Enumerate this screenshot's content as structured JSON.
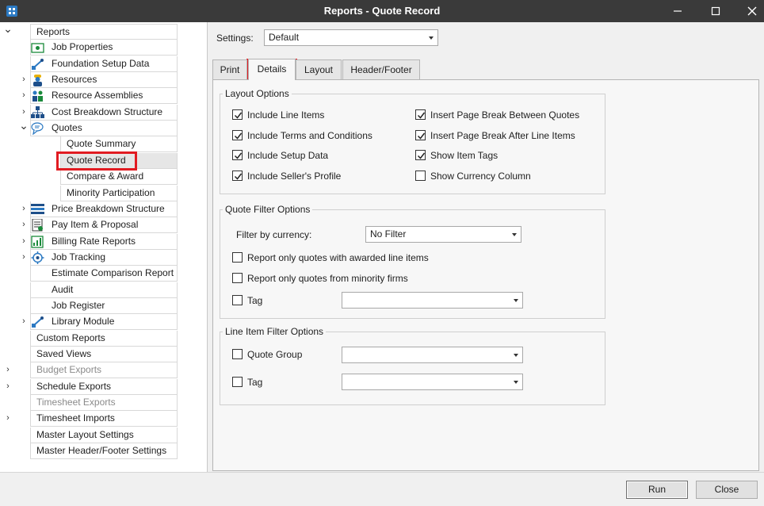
{
  "window": {
    "title": "Reports - Quote Record",
    "minimize": "—",
    "maximize": "☐",
    "close": "✕"
  },
  "tree": {
    "items": [
      {
        "label": "Reports",
        "chevron": "⌄",
        "icon": ""
      },
      {
        "label": "Job Properties",
        "chevron": "",
        "icon": "job-properties-icon"
      },
      {
        "label": "Foundation Setup Data",
        "chevron": "",
        "icon": "foundation-icon"
      },
      {
        "label": "Resources",
        "chevron": "›",
        "icon": "resources-icon"
      },
      {
        "label": "Resource Assemblies",
        "chevron": "›",
        "icon": "resource-assemblies-icon"
      },
      {
        "label": "Cost Breakdown Structure",
        "chevron": "›",
        "icon": "cost-breakdown-icon"
      },
      {
        "label": "Quotes",
        "chevron": "⌄",
        "icon": "quotes-icon"
      },
      {
        "label": "Quote Summary",
        "chevron": "",
        "icon": ""
      },
      {
        "label": "Quote Record",
        "chevron": "",
        "icon": ""
      },
      {
        "label": "Compare & Award",
        "chevron": "",
        "icon": ""
      },
      {
        "label": "Minority Participation",
        "chevron": "",
        "icon": ""
      },
      {
        "label": "Price Breakdown Structure",
        "chevron": "›",
        "icon": "price-breakdown-icon"
      },
      {
        "label": "Pay Item & Proposal",
        "chevron": "›",
        "icon": "pay-item-icon"
      },
      {
        "label": "Billing Rate Reports",
        "chevron": "›",
        "icon": "billing-rate-icon"
      },
      {
        "label": "Job Tracking",
        "chevron": "›",
        "icon": "job-tracking-icon"
      },
      {
        "label": "Estimate Comparison Report",
        "chevron": "",
        "icon": ""
      },
      {
        "label": "Audit",
        "chevron": "",
        "icon": ""
      },
      {
        "label": "Job Register",
        "chevron": "",
        "icon": ""
      },
      {
        "label": "Library Module",
        "chevron": "›",
        "icon": "library-icon"
      },
      {
        "label": "Custom Reports",
        "chevron": "",
        "icon": ""
      },
      {
        "label": "Saved Views",
        "chevron": "",
        "icon": ""
      },
      {
        "label": "Budget Exports",
        "chevron": "›",
        "icon": ""
      },
      {
        "label": "Schedule Exports",
        "chevron": "›",
        "icon": ""
      },
      {
        "label": "Timesheet Exports",
        "chevron": "",
        "icon": ""
      },
      {
        "label": "Timesheet Imports",
        "chevron": "›",
        "icon": ""
      },
      {
        "label": "Master Layout Settings",
        "chevron": "",
        "icon": ""
      },
      {
        "label": "Master Header/Footer Settings",
        "chevron": "",
        "icon": ""
      }
    ]
  },
  "settings": {
    "label": "Settings:",
    "value": "Default"
  },
  "tabs": [
    {
      "label": "Print"
    },
    {
      "label": "Details"
    },
    {
      "label": "Layout"
    },
    {
      "label": "Header/Footer"
    }
  ],
  "layout_options": {
    "title": "Layout Options",
    "left": [
      {
        "label": "Include Line Items",
        "checked": true
      },
      {
        "label": "Include Terms and Conditions",
        "checked": true
      },
      {
        "label": "Include Setup Data",
        "checked": true
      },
      {
        "label": "Include Seller's Profile",
        "checked": true
      }
    ],
    "right": [
      {
        "label": "Insert Page Break Between Quotes",
        "checked": true
      },
      {
        "label": "Insert Page Break After Line Items",
        "checked": true
      },
      {
        "label": "Show Item Tags",
        "checked": true
      },
      {
        "label": "Show Currency Column",
        "checked": false
      }
    ]
  },
  "quote_filter": {
    "title": "Quote Filter Options",
    "currency_label": "Filter by currency:",
    "currency_value": "No Filter",
    "awarded_label": "Report only quotes with awarded line items",
    "awarded_checked": false,
    "minority_label": "Report only quotes from minority firms",
    "minority_checked": false,
    "tag_label": "Tag",
    "tag_checked": false,
    "tag_value": ""
  },
  "line_item_filter": {
    "title": "Line Item Filter Options",
    "group_label": "Quote Group",
    "group_checked": false,
    "group_value": "",
    "tag_label": "Tag",
    "tag_checked": false,
    "tag_value": ""
  },
  "buttons": {
    "run": "Run",
    "close": "Close"
  },
  "colors": {
    "highlight": "#e11b22",
    "titlebar": "#3a3a3a",
    "accent": "#2b79c2"
  }
}
